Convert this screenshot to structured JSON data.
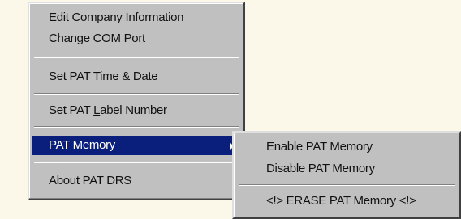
{
  "main_menu": {
    "items": [
      {
        "label": "Edit Company Information"
      },
      {
        "label": "Change COM Port"
      },
      {
        "label": "Set PAT Time & Date"
      },
      {
        "label_pre": "Set PAT ",
        "label_accel": "L",
        "label_post": "abel Number"
      },
      {
        "label": "PAT Memory",
        "has_submenu": true,
        "highlighted": true
      },
      {
        "label": "About PAT DRS"
      }
    ],
    "highlight_color": "#0a1f7c"
  },
  "sub_menu": {
    "items": [
      {
        "label": "Enable PAT Memory"
      },
      {
        "label": "Disable PAT Memory"
      },
      {
        "label": "<!> ERASE PAT Memory <!>"
      }
    ]
  },
  "colors": {
    "menu_bg": "#c0c0c0",
    "page_bg": "#fbf8ea"
  },
  "icons": {
    "submenu_arrow": "triangle-right-icon"
  }
}
